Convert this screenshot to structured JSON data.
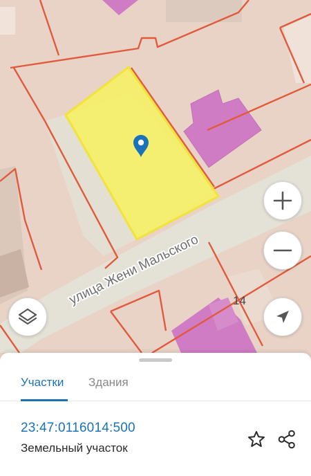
{
  "map": {
    "street_label": "улица Жени Мальского",
    "house_number": "14",
    "colors": {
      "background": "#e8d3c6",
      "road": "#e3e0d5",
      "parcel_boundary": "#e25a3c",
      "building": "#cf7cc4",
      "selected_parcel_fill": "#f4ee6c",
      "selected_parcel_border": "#f2e33a",
      "marker": "#1a73b8"
    },
    "icons": {
      "marker": "map-pin-icon",
      "zoom_in": "plus-icon",
      "zoom_out": "minus-icon",
      "locate": "navigation-arrow-icon",
      "layers": "layers-icon"
    }
  },
  "sheet": {
    "tabs": [
      {
        "label": "Участки",
        "active": true
      },
      {
        "label": "Здания",
        "active": false
      }
    ],
    "parcel": {
      "cadastral_number": "23:47:0116014:500",
      "type": "Земельный участок"
    },
    "icons": {
      "favorite": "star-icon",
      "share": "share-icon"
    },
    "accent_color": "#1a73b8"
  }
}
